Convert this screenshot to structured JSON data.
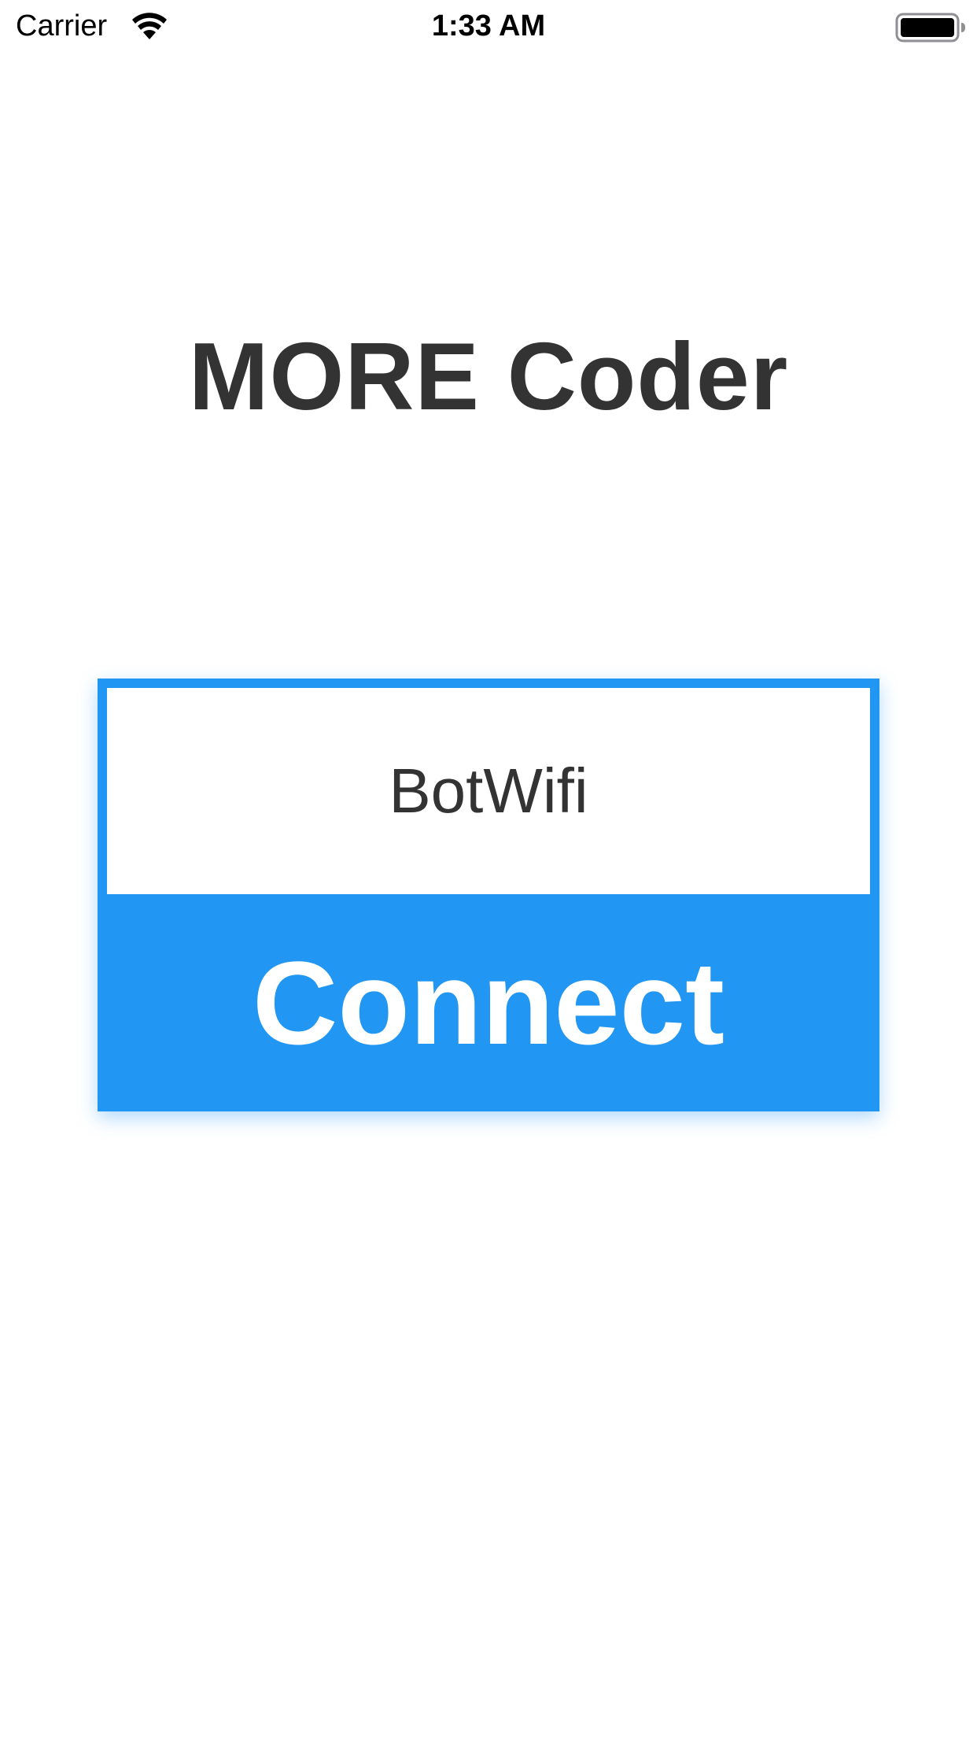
{
  "status_bar": {
    "carrier": "Carrier",
    "time": "1:33 AM",
    "icons": [
      "wifi-icon",
      "battery-icon"
    ]
  },
  "app": {
    "title": "MORE Coder"
  },
  "connect_panel": {
    "network_value": "BotWifi",
    "connect_label": "Connect"
  },
  "colors": {
    "accent": "#2196f3",
    "title_text": "#333333",
    "background": "#ffffff"
  }
}
